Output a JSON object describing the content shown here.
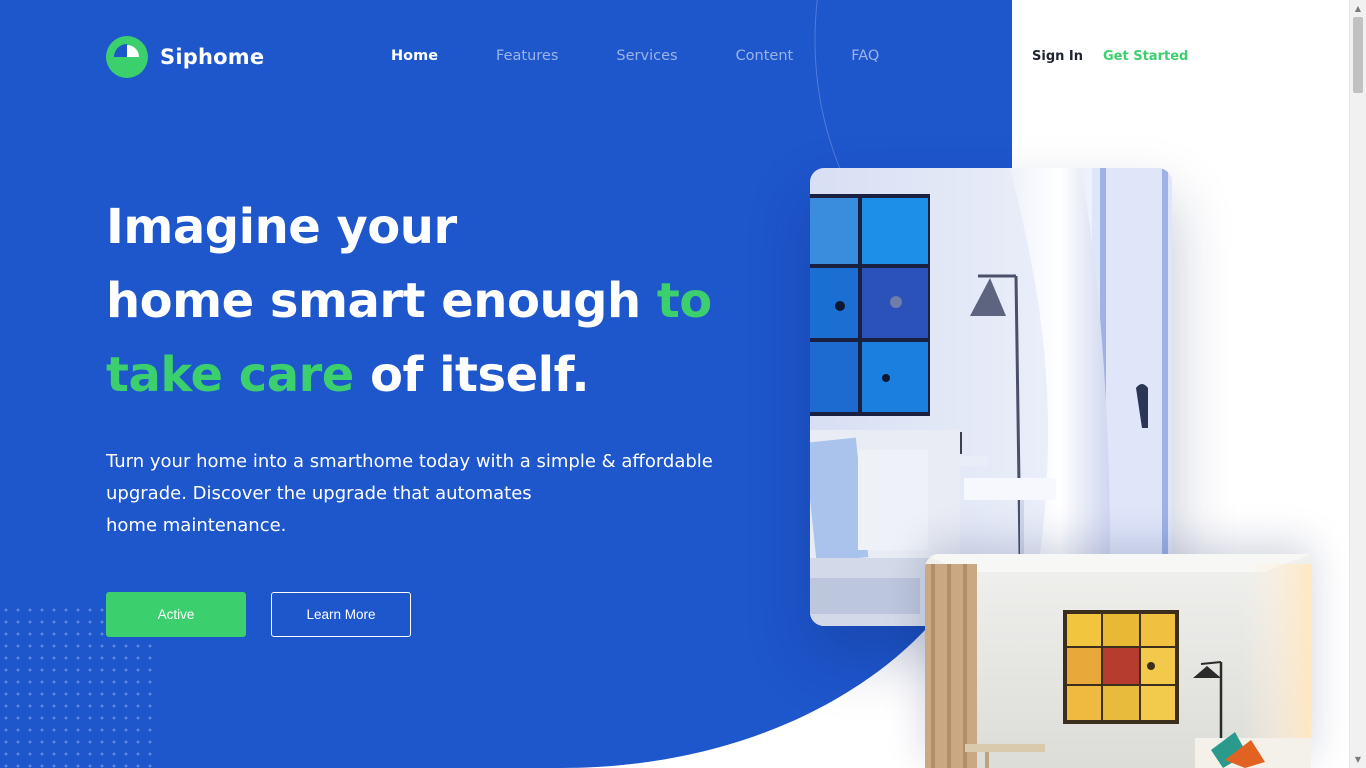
{
  "brand": {
    "name": "Siphome",
    "logo_icon": "half-circle-logo-icon",
    "accent": "#3ccf6e",
    "primary_bg": "#1e56cc"
  },
  "nav": {
    "items": [
      {
        "label": "Home",
        "active": true
      },
      {
        "label": "Features",
        "active": false
      },
      {
        "label": "Services",
        "active": false
      },
      {
        "label": "Content",
        "active": false
      },
      {
        "label": "FAQ",
        "active": false
      }
    ],
    "sign_in": "Sign In",
    "get_started": "Get Started"
  },
  "hero": {
    "headline": {
      "line1": "Imagine your",
      "line2_white": "home smart enough ",
      "line2_green": "to",
      "line3_green": "take care",
      "line3_white": " of itself."
    },
    "subtitle": {
      "line1": "Turn your home into a smarthome today with a simple & affordable",
      "line2": "upgrade. Discover the upgrade that automates",
      "line3": "home maintenance."
    },
    "primary_button": "Active",
    "secondary_button": "Learn More"
  },
  "images": {
    "top": "living-room-blue-panels-photo",
    "bottom": "living-room-yellow-panels-photo"
  }
}
